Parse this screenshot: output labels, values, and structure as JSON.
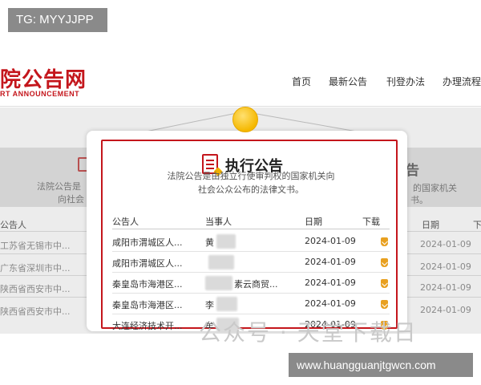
{
  "overlays": {
    "tg_label": "TG: MYYJJPP",
    "url_label": "www.huangguanjtgwcn.com",
    "watermark": "公众号 · 天堂下载日"
  },
  "header": {
    "logo_text": "院公告网",
    "logo_sub": "RT ANNOUNCEMENT",
    "nav": [
      "首页",
      "最新公告",
      "刊登办法",
      "办理流程"
    ]
  },
  "background": {
    "left_desc_1": "法院公告是",
    "left_desc_2": "向社会",
    "right_head": "告",
    "right_desc_1": "的国家机关",
    "right_desc_2": "书。",
    "left_col_header": "公告人",
    "right_col_header_1": "日期",
    "right_col_header_2": "下",
    "left_rows": [
      "工苏省无锡市中...",
      "广东省深圳市中...",
      "陕西省西安市中...",
      "陕西省西安市中..."
    ],
    "right_dates": [
      "2024-01-09",
      "2024-01-09",
      "2024-01-09",
      "2024-01-09"
    ]
  },
  "card": {
    "title": "执行公告",
    "desc_line1": "法院公告是由独立行使审判权的国家机关向",
    "desc_line2": "社会公众公布的法律文书。",
    "columns": {
      "announcer": "公告人",
      "party": "当事人",
      "date": "日期",
      "download": "下载"
    },
    "rows": [
      {
        "announcer": "咸阳市渭城区人...",
        "party": "黄",
        "date": "2024-01-09"
      },
      {
        "announcer": "咸阳市渭城区人...",
        "party": "",
        "date": "2024-01-09"
      },
      {
        "announcer": "秦皇岛市海港区...",
        "party": "素云商贸...",
        "date": "2024-01-09"
      },
      {
        "announcer": "秦皇岛市海港区...",
        "party": "李",
        "date": "2024-01-09"
      },
      {
        "announcer": "大连经济技术开...",
        "party": "牟",
        "date": "2024-01-09"
      }
    ]
  }
}
